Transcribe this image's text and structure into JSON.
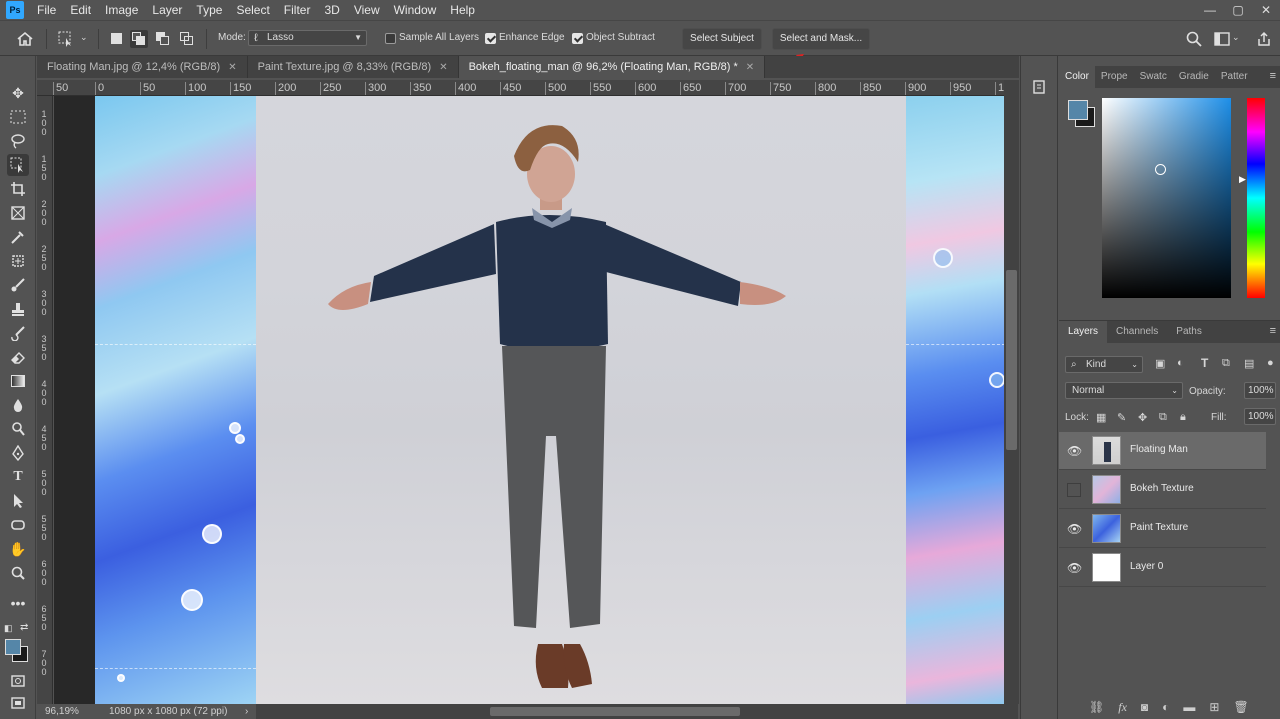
{
  "app": {
    "logo": "Ps"
  },
  "menu": [
    "File",
    "Edit",
    "Image",
    "Layer",
    "Type",
    "Select",
    "Filter",
    "3D",
    "View",
    "Window",
    "Help"
  ],
  "window_controls": [
    "—",
    "▢",
    "✕"
  ],
  "options": {
    "mode_label": "Mode:",
    "mode_value": "Lasso",
    "sample_all_layers": "Sample All Layers",
    "enhance_edge": "Enhance Edge",
    "object_subtract": "Object Subtract",
    "select_subject": "Select Subject",
    "select_and_mask": "Select and Mask..."
  },
  "tabs": [
    {
      "label": "Floating Man.jpg @ 12,4% (RGB/8)",
      "active": false
    },
    {
      "label": "Paint Texture.jpg @ 8,33% (RGB/8)",
      "active": false
    },
    {
      "label": "Bokeh_floating_man @ 96,2% (Floating Man, RGB/8) *",
      "active": true
    }
  ],
  "ruler_top": [
    "50",
    "0",
    "50",
    "100",
    "150",
    "200",
    "250",
    "300",
    "350",
    "400",
    "450",
    "500",
    "550",
    "600",
    "650",
    "700",
    "750",
    "800",
    "850",
    "900",
    "950",
    "1"
  ],
  "ruler_left": [
    "1",
    "0",
    "0",
    "1",
    "5",
    "0",
    "2",
    "0",
    "0",
    "2",
    "5",
    "0",
    "3",
    "0",
    "0",
    "3",
    "5",
    "0",
    "4",
    "0",
    "0",
    "4",
    "5",
    "0",
    "5",
    "0",
    "0",
    "5",
    "5",
    "0",
    "6",
    "0",
    "0",
    "6",
    "5",
    "0",
    "7",
    "0",
    "0"
  ],
  "status": {
    "zoom": "96,19%",
    "doc_size": "1080 px x 1080 px (72 ppi)"
  },
  "color_panel": {
    "tabs": [
      "Color",
      "Prope",
      "Swatc",
      "Gradie",
      "Patter"
    ],
    "fg_color": "#5586a8",
    "bg_color": "#1a1a1a"
  },
  "layers_panel": {
    "tabs": [
      "Layers",
      "Channels",
      "Paths"
    ],
    "filter": "Kind",
    "blend_mode": "Normal",
    "opacity_label": "Opacity:",
    "opacity_value": "100%",
    "lock_label": "Lock:",
    "fill_label": "Fill:",
    "fill_value": "100%",
    "layers": [
      {
        "name": "Floating Man",
        "visible": true,
        "selected": true
      },
      {
        "name": "Bokeh Texture",
        "visible": false,
        "selected": false
      },
      {
        "name": "Paint Texture",
        "visible": true,
        "selected": false
      },
      {
        "name": "Layer 0",
        "visible": true,
        "selected": false
      }
    ]
  }
}
